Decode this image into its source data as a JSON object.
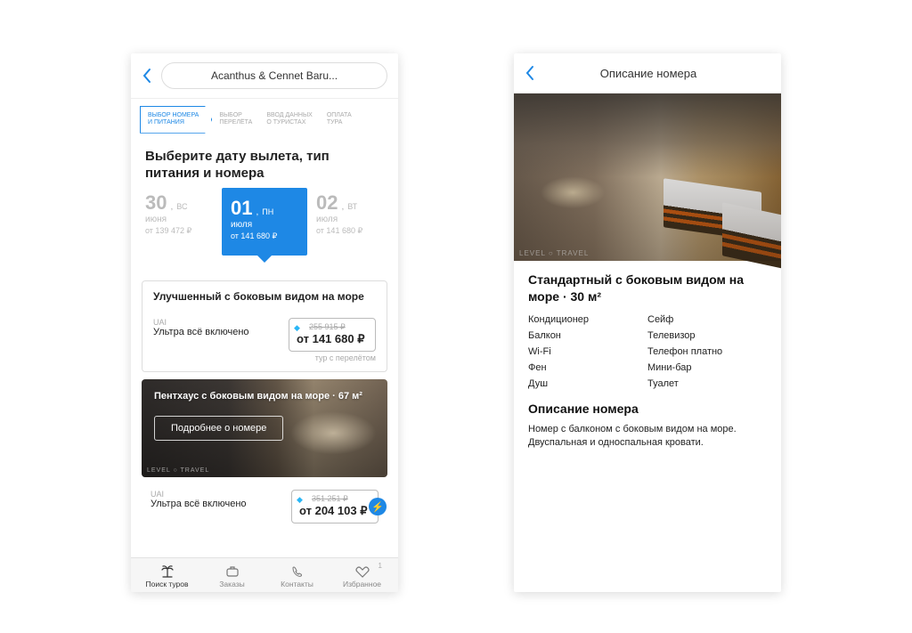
{
  "left": {
    "header_title": "Acanthus & Cennet Baru...",
    "steps": [
      "ВЫБОР НОМЕРА\nИ ПИТАНИЯ",
      "ВЫБОР\nПЕРЕЛЁТА",
      "ВВОД ДАННЫХ\nО ТУРИСТАХ",
      "ОПЛАТА\nТУРА"
    ],
    "section_heading": "Выберите дату вылета, тип питания и номера",
    "dates": [
      {
        "day": "30",
        "wd": "ВС",
        "month": "июня",
        "price": "от 139 472 ₽"
      },
      {
        "day": "01",
        "wd": "ПН",
        "month": "июля",
        "price": "от 141 680 ₽",
        "selected": true
      },
      {
        "day": "02",
        "wd": "ВТ",
        "month": "июля",
        "price": "от 141 680 ₽"
      }
    ],
    "room1": {
      "title": "Улучшенный с боковым видом на море",
      "code": "UAI",
      "desc": "Ультра всё включено",
      "old_price": "255 915 ₽",
      "price": "от 141 680 ₽",
      "note": "тур с перелётом"
    },
    "penthouse": {
      "title": "Пентхаус с боковым видом на море · 67 м²",
      "button": "Подробнее о номере",
      "watermark": "LEVEL ○ TRAVEL"
    },
    "room2": {
      "code": "UAI",
      "desc": "Ультра всё включено",
      "old_price": "351 251 ₽",
      "price": "от 204 103 ₽"
    },
    "tabs": [
      {
        "label": "Поиск туров"
      },
      {
        "label": "Заказы"
      },
      {
        "label": "Контакты"
      },
      {
        "label": "Избранное",
        "badge": "1"
      }
    ]
  },
  "right": {
    "header_title": "Описание номера",
    "watermark": "LEVEL ○ TRAVEL",
    "title": "Стандартный с боковым видом на море · 30 м²",
    "amenities_left": [
      "Кондиционер",
      "Балкон",
      "Wi-Fi",
      "Фен",
      "Душ"
    ],
    "amenities_right": [
      "Сейф",
      "Телевизор",
      "Телефон платно",
      "Мини-бар",
      "Туалет"
    ],
    "desc_heading": "Описание номера",
    "desc_text": "Номер с балконом с боковым видом на море. Двуспальная и односпальная кровати."
  }
}
